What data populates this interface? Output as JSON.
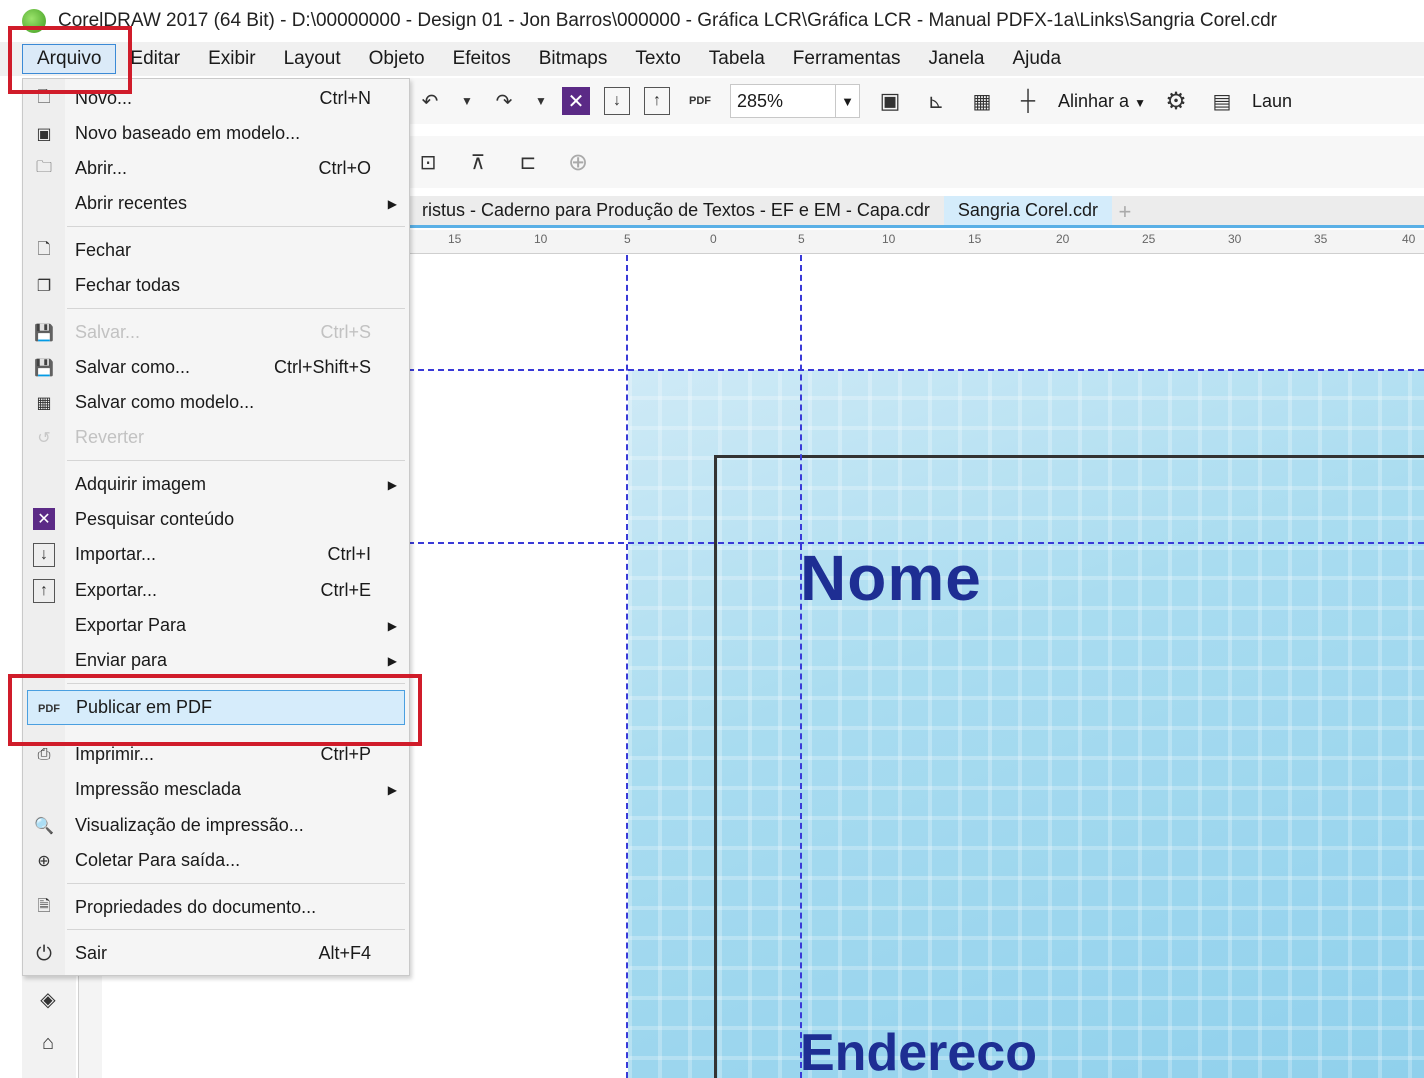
{
  "window": {
    "title": "CorelDRAW 2017 (64 Bit) - D:\\00000000 - Design 01 - Jon Barros\\000000 - Gráfica LCR\\Gráfica LCR - Manual PDFX-1a\\Links\\Sangria Corel.cdr"
  },
  "menubar": {
    "items": [
      "Arquivo",
      "Editar",
      "Exibir",
      "Layout",
      "Objeto",
      "Efeitos",
      "Bitmaps",
      "Texto",
      "Tabela",
      "Ferramentas",
      "Janela",
      "Ajuda"
    ]
  },
  "toolbar": {
    "zoom_value": "285%",
    "align_label": "Alinhar a",
    "launch_label": "Laun"
  },
  "tabs": {
    "inactive": "ristus - Caderno para Produção de Textos - EF e EM - Capa.cdr",
    "active": "Sangria Corel.cdr"
  },
  "ruler": {
    "labels": [
      "15",
      "10",
      "5",
      "0",
      "5",
      "10",
      "15",
      "20",
      "25",
      "30",
      "35",
      "40"
    ]
  },
  "canvas": {
    "name_text": "Nome",
    "address_text": "Endereco"
  },
  "file_menu": {
    "items": [
      {
        "label": "Novo...",
        "shortcut": "Ctrl+N",
        "icon": "new-document-icon"
      },
      {
        "label": "Novo baseado em modelo...",
        "shortcut": "",
        "icon": "new-from-template-icon"
      },
      {
        "label": "Abrir...",
        "shortcut": "Ctrl+O",
        "icon": "open-folder-icon"
      },
      {
        "label": "Abrir recentes",
        "shortcut": "",
        "icon": ""
      },
      {
        "label": "Fechar",
        "shortcut": "",
        "icon": "close-document-icon"
      },
      {
        "label": "Fechar todas",
        "shortcut": "",
        "icon": "close-all-icon"
      },
      {
        "label": "Salvar...",
        "shortcut": "Ctrl+S",
        "icon": "save-icon"
      },
      {
        "label": "Salvar como...",
        "shortcut": "Ctrl+Shift+S",
        "icon": "save-as-icon"
      },
      {
        "label": "Salvar como modelo...",
        "shortcut": "",
        "icon": "save-as-template-icon"
      },
      {
        "label": "Reverter",
        "shortcut": "",
        "icon": "revert-icon"
      },
      {
        "label": "Adquirir imagem",
        "shortcut": "",
        "icon": ""
      },
      {
        "label": "Pesquisar conteúdo",
        "shortcut": "",
        "icon": "search-content-icon"
      },
      {
        "label": "Importar...",
        "shortcut": "Ctrl+I",
        "icon": "import-icon"
      },
      {
        "label": "Exportar...",
        "shortcut": "Ctrl+E",
        "icon": "export-icon"
      },
      {
        "label": "Exportar Para",
        "shortcut": "",
        "icon": ""
      },
      {
        "label": "Enviar para",
        "shortcut": "",
        "icon": ""
      },
      {
        "label": "Publicar em PDF",
        "shortcut": "",
        "icon": "pdf-icon"
      },
      {
        "label": "Imprimir...",
        "shortcut": "Ctrl+P",
        "icon": "print-icon"
      },
      {
        "label": "Impressão mesclada",
        "shortcut": "",
        "icon": ""
      },
      {
        "label": "Visualização de impressão...",
        "shortcut": "",
        "icon": "print-preview-icon"
      },
      {
        "label": "Coletar Para saída...",
        "shortcut": "",
        "icon": "collect-for-output-icon"
      },
      {
        "label": "Propriedades do documento...",
        "shortcut": "",
        "icon": "document-properties-icon"
      },
      {
        "label": "Sair",
        "shortcut": "Alt+F4",
        "icon": "power-icon"
      }
    ]
  },
  "colors": {
    "highlight_box": "#d01c2a",
    "selection": "#d6ecfb",
    "artwork_text": "#1e2e93",
    "guide": "#3a3ad8"
  }
}
